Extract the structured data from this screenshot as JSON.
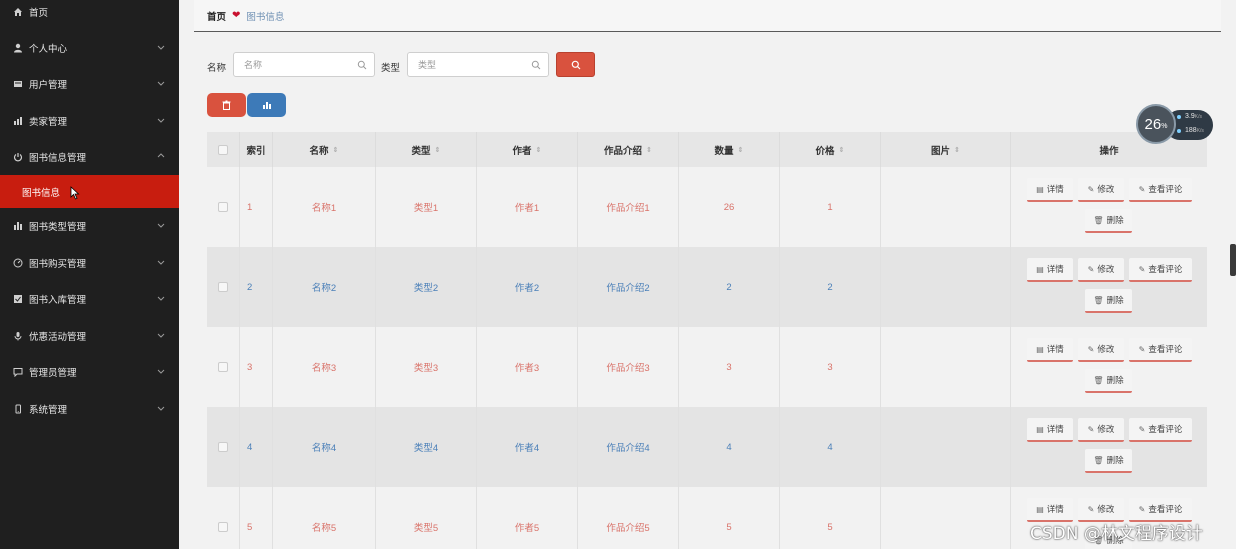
{
  "sidebar": {
    "items": [
      {
        "label": "首页",
        "icon": "home-icon",
        "has_chevron": false
      },
      {
        "label": "个人中心",
        "icon": "user-icon",
        "has_chevron": true
      },
      {
        "label": "用户管理",
        "icon": "user-list-icon",
        "has_chevron": true
      },
      {
        "label": "卖家管理",
        "icon": "seller-icon",
        "has_chevron": true
      },
      {
        "label": "图书信息管理",
        "icon": "power-icon",
        "has_chevron": true
      },
      {
        "label": "图书类型管理",
        "icon": "bar-chart-icon",
        "has_chevron": true
      },
      {
        "label": "图书购买管理",
        "icon": "gauge-icon",
        "has_chevron": true
      },
      {
        "label": "图书入库管理",
        "icon": "inbox-icon",
        "has_chevron": true
      },
      {
        "label": "优惠活动管理",
        "icon": "microphone-icon",
        "has_chevron": true
      },
      {
        "label": "管理员管理",
        "icon": "message-icon",
        "has_chevron": true
      },
      {
        "label": "系统管理",
        "icon": "phone-icon",
        "has_chevron": true
      }
    ],
    "active_sub": "图书信息"
  },
  "breadcrumb": {
    "home": "首页",
    "current": "图书信息"
  },
  "search": {
    "name_label": "名称",
    "name_placeholder": "名称",
    "type_label": "类型",
    "type_placeholder": "类型"
  },
  "table": {
    "headers": [
      "索引",
      "名称",
      "类型",
      "作者",
      "作品介绍",
      "数量",
      "价格",
      "图片",
      "操作"
    ],
    "rows": [
      {
        "index": "1",
        "name": "名称1",
        "type": "类型1",
        "author": "作者1",
        "intro": "作品介绍1",
        "qty": "26",
        "price": "1"
      },
      {
        "index": "2",
        "name": "名称2",
        "type": "类型2",
        "author": "作者2",
        "intro": "作品介绍2",
        "qty": "2",
        "price": "2"
      },
      {
        "index": "3",
        "name": "名称3",
        "type": "类型3",
        "author": "作者3",
        "intro": "作品介绍3",
        "qty": "3",
        "price": "3"
      },
      {
        "index": "4",
        "name": "名称4",
        "type": "类型4",
        "author": "作者4",
        "intro": "作品介绍4",
        "qty": "4",
        "price": "4"
      },
      {
        "index": "5",
        "name": "名称5",
        "type": "类型5",
        "author": "作者5",
        "intro": "作品介绍5",
        "qty": "5",
        "price": "5"
      }
    ],
    "ops": {
      "detail": "详情",
      "edit": "修改",
      "comments": "查看评论",
      "delete": "删除"
    }
  },
  "widget": {
    "percent": "26",
    "unit": "%",
    "line1": "3.9",
    "line1_unit": "K/s",
    "line2": "188",
    "line2_unit": "K/s"
  },
  "watermark": "CSDN @林文程序设计",
  "colors": {
    "accent_red": "#c81d0f",
    "button_red": "#d9523e",
    "button_blue": "#3d7ab8",
    "text_red": "#d9736a",
    "text_blue": "#4a7fb8"
  }
}
